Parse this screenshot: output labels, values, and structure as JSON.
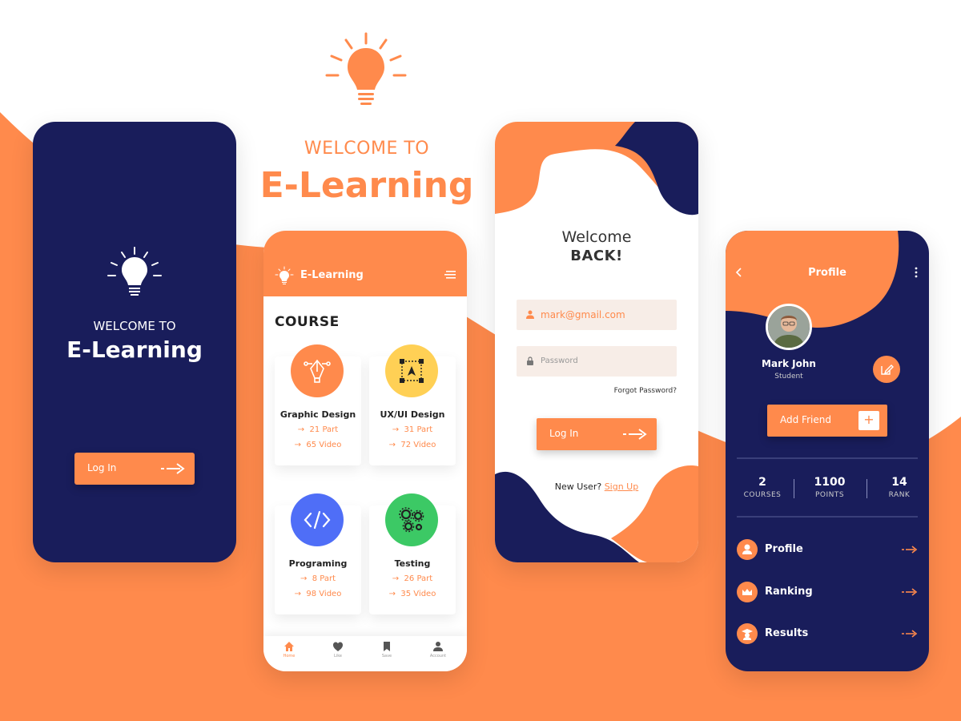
{
  "hero": {
    "welcome": "WELCOME TO",
    "title": "E-Learning"
  },
  "splash": {
    "welcome": "WELCOME TO",
    "title": "E-Learning",
    "login_label": "Log In"
  },
  "course_screen": {
    "app_name": "E-Learning",
    "section_title": "COURSE",
    "courses": [
      {
        "name": "Graphic Design",
        "parts": "21 Part",
        "videos": "65 Video",
        "color": "#ff8a4c"
      },
      {
        "name": "UX/UI Design",
        "parts": "31 Part",
        "videos": "72 Video",
        "color": "#ffd055"
      },
      {
        "name": "Programing",
        "parts": "8 Part",
        "videos": "98 Video",
        "color": "#4f6ef7"
      },
      {
        "name": "Testing",
        "parts": "26 Part",
        "videos": "35 Video",
        "color": "#3cc965"
      }
    ],
    "nav": [
      {
        "label": "Home",
        "icon": "home-icon"
      },
      {
        "label": "Like",
        "icon": "heart-icon"
      },
      {
        "label": "Save",
        "icon": "bookmark-icon"
      },
      {
        "label": "Account",
        "icon": "user-icon"
      }
    ]
  },
  "login_screen": {
    "welcome": "Welcome",
    "back": "BACK!",
    "email_value": "mark@gmail.com",
    "password_placeholder": "Password",
    "forgot": "Forgot Password?",
    "login_label": "Log In",
    "new_user": "New User?",
    "sign_up": "Sign Up"
  },
  "profile_screen": {
    "title": "Profile",
    "name": "Mark John",
    "role": "Student",
    "add_friend": "Add Friend",
    "stats": [
      {
        "value": "2",
        "label": "COURSES"
      },
      {
        "value": "1100",
        "label": "POINTS"
      },
      {
        "value": "14",
        "label": "RANK"
      }
    ],
    "menu": [
      {
        "label": "Profile",
        "icon": "user-icon"
      },
      {
        "label": "Ranking",
        "icon": "crown-icon"
      },
      {
        "label": "Results",
        "icon": "graduate-icon"
      }
    ]
  },
  "colors": {
    "accent": "#ff8a4c",
    "navy": "#191d5b",
    "field_bg": "#f7ede7"
  }
}
